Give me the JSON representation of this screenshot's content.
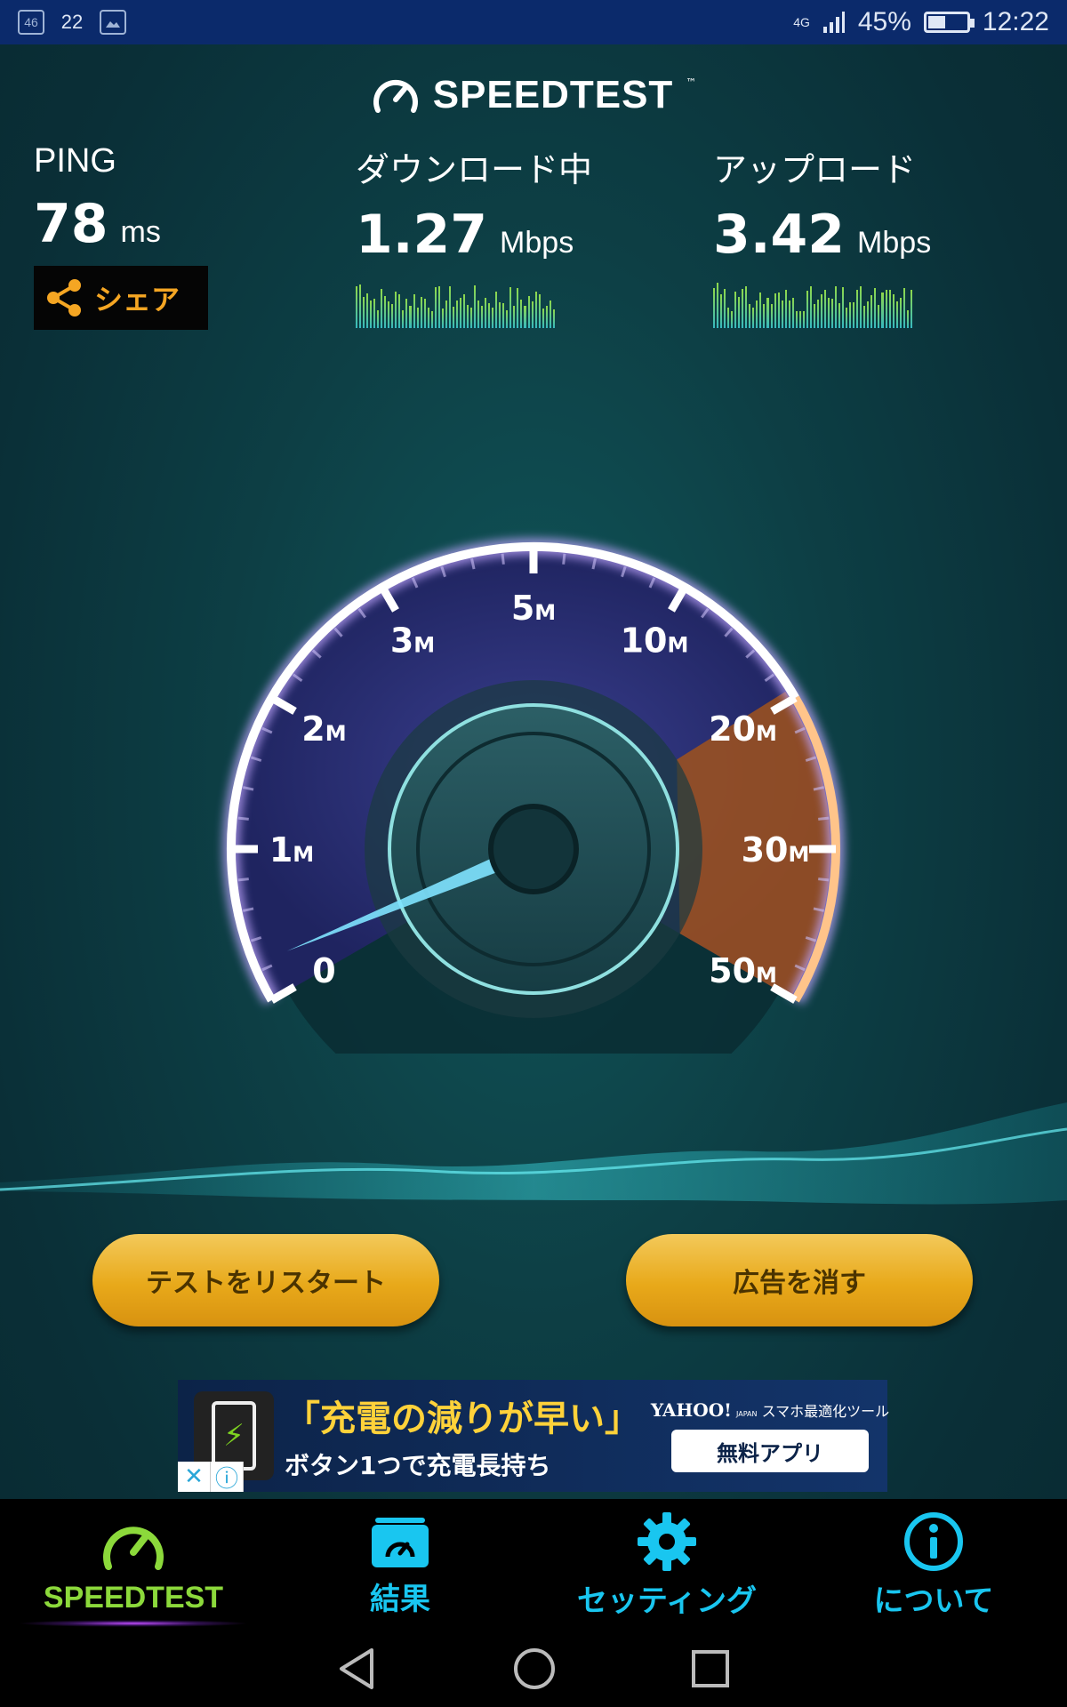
{
  "status_bar": {
    "left_icons": [
      "46",
      "22"
    ],
    "network": "4G",
    "battery_level": 0.45,
    "battery": "45%",
    "time": "12:22"
  },
  "app": {
    "logo_text": "SPEEDTEST",
    "logo_tm": "™"
  },
  "ping": {
    "label": "PING",
    "value": "78",
    "unit": "ms",
    "share_label": "シェア"
  },
  "download": {
    "label": "ダウンロード中",
    "value": "1.27",
    "unit": "Mbps"
  },
  "upload": {
    "label": "アップロード",
    "value": "3.42",
    "unit": "Mbps"
  },
  "gauge": {
    "ticks": [
      {
        "num": "0",
        "unit": ""
      },
      {
        "num": "1",
        "unit": "M"
      },
      {
        "num": "2",
        "unit": "M"
      },
      {
        "num": "3",
        "unit": "M"
      },
      {
        "num": "5",
        "unit": "M"
      },
      {
        "num": "10",
        "unit": "M"
      },
      {
        "num": "20",
        "unit": "M"
      },
      {
        "num": "30",
        "unit": "M"
      },
      {
        "num": "50",
        "unit": "M"
      }
    ],
    "current_mbps": 1.27,
    "colors": {
      "arc_low": "#b69cff",
      "arc_high": "#ff9b4a",
      "face": "#2d3178",
      "needle": "#7fe3ff"
    }
  },
  "buttons": {
    "restart": "テストをリスタート",
    "remove_ads": "広告を消す"
  },
  "ad": {
    "headline": "「充電の減りが早い」",
    "subline": "ボタン1つで充電長持ち",
    "brand": "YAHOO!",
    "brand_sub": "JAPAN",
    "brand_tag": "スマホ最適化ツール",
    "cta": "無料アプリ",
    "close": "✕",
    "info": "ⓘ"
  },
  "tabs": [
    {
      "label": "SPEEDTEST",
      "icon": "speedometer-icon",
      "active": true
    },
    {
      "label": "結果",
      "icon": "results-icon",
      "active": false
    },
    {
      "label": "セッティング",
      "icon": "gear-icon",
      "active": false
    },
    {
      "label": "について",
      "icon": "info-icon",
      "active": false
    }
  ]
}
